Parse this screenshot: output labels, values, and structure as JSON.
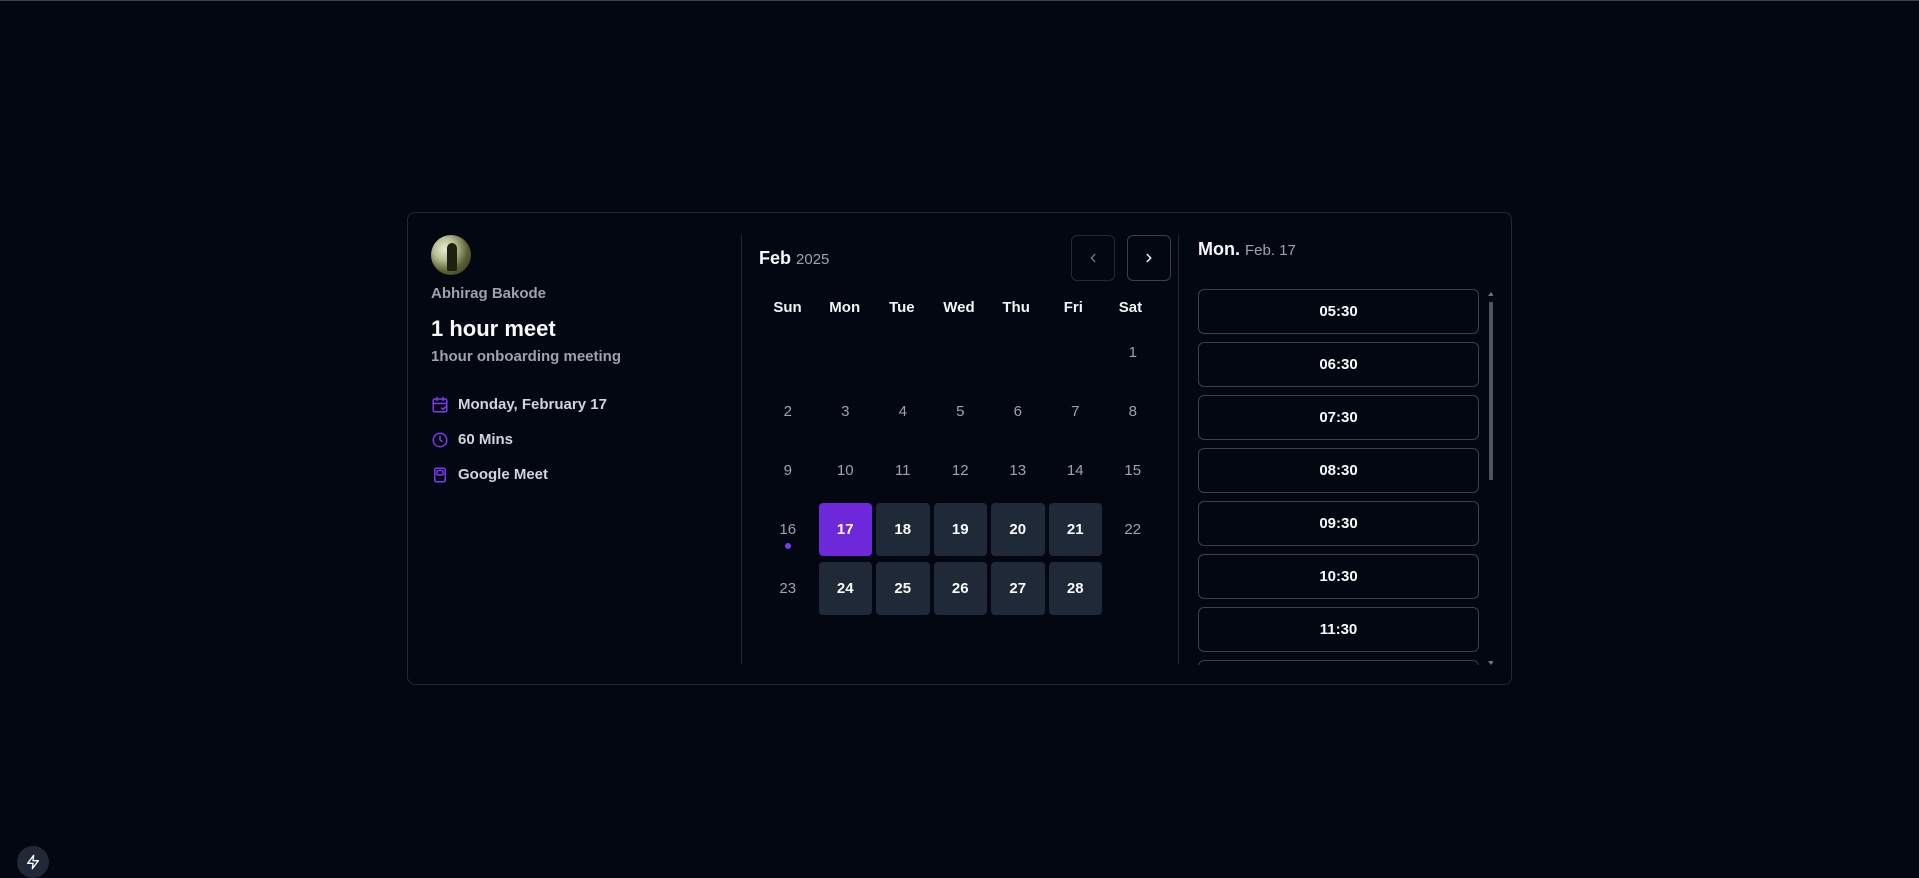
{
  "host": {
    "name": "Abhirag Bakode"
  },
  "event": {
    "title": "1 hour meet",
    "description": "1hour onboarding meeting",
    "details": [
      {
        "icon": "calendar-icon",
        "text": "Monday, February 17"
      },
      {
        "icon": "clock-icon",
        "text": "60 Mins"
      },
      {
        "icon": "video-icon",
        "text": "Google Meet"
      }
    ]
  },
  "calendar": {
    "month": "Feb",
    "year": "2025",
    "weekdays": [
      "Sun",
      "Mon",
      "Tue",
      "Wed",
      "Thu",
      "Fri",
      "Sat"
    ],
    "days": [
      {
        "label": "",
        "state": "empty"
      },
      {
        "label": "",
        "state": "empty"
      },
      {
        "label": "",
        "state": "empty"
      },
      {
        "label": "",
        "state": "empty"
      },
      {
        "label": "",
        "state": "empty"
      },
      {
        "label": "",
        "state": "empty"
      },
      {
        "label": "1",
        "state": "off"
      },
      {
        "label": "2",
        "state": "off"
      },
      {
        "label": "3",
        "state": "off"
      },
      {
        "label": "4",
        "state": "off"
      },
      {
        "label": "5",
        "state": "off"
      },
      {
        "label": "6",
        "state": "off"
      },
      {
        "label": "7",
        "state": "off"
      },
      {
        "label": "8",
        "state": "off"
      },
      {
        "label": "9",
        "state": "off"
      },
      {
        "label": "10",
        "state": "off"
      },
      {
        "label": "11",
        "state": "off"
      },
      {
        "label": "12",
        "state": "off"
      },
      {
        "label": "13",
        "state": "off"
      },
      {
        "label": "14",
        "state": "off"
      },
      {
        "label": "15",
        "state": "off"
      },
      {
        "label": "16",
        "state": "today"
      },
      {
        "label": "17",
        "state": "selected"
      },
      {
        "label": "18",
        "state": "avail"
      },
      {
        "label": "19",
        "state": "avail"
      },
      {
        "label": "20",
        "state": "avail"
      },
      {
        "label": "21",
        "state": "avail"
      },
      {
        "label": "22",
        "state": "off"
      },
      {
        "label": "23",
        "state": "off"
      },
      {
        "label": "24",
        "state": "avail"
      },
      {
        "label": "25",
        "state": "avail"
      },
      {
        "label": "26",
        "state": "avail"
      },
      {
        "label": "27",
        "state": "avail"
      },
      {
        "label": "28",
        "state": "avail"
      }
    ]
  },
  "slots": {
    "day": "Mon.",
    "date": "Feb. 17",
    "times": [
      "05:30",
      "06:30",
      "07:30",
      "08:30",
      "09:30",
      "10:30",
      "11:30",
      ""
    ]
  },
  "colors": {
    "accent": "#6d28d9",
    "background": "#030712",
    "cell": "#1f2937"
  }
}
